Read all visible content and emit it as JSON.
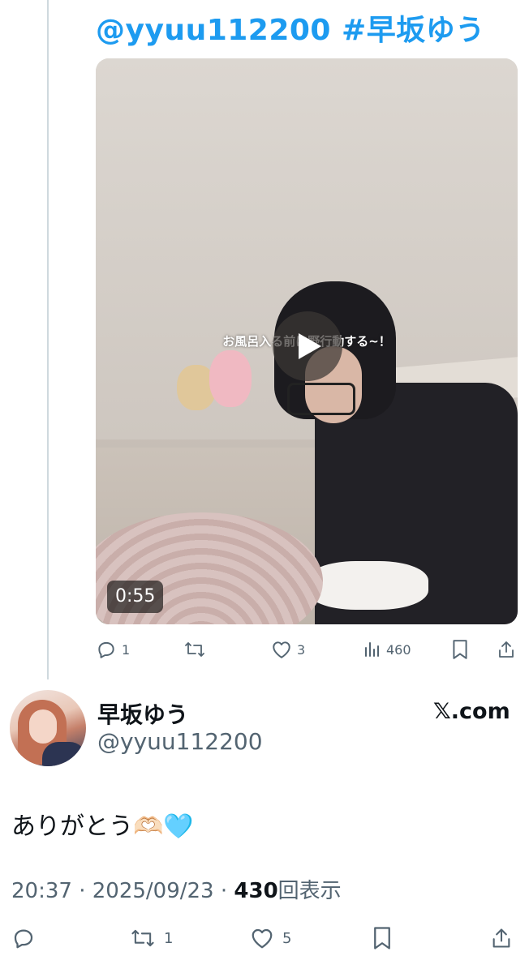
{
  "reply_context": {
    "mention": "@yyuu112200",
    "hashtag": "#早坂ゆう"
  },
  "video": {
    "overlay_caption": "お風呂入る前に野行動する~！",
    "duration": "0:55",
    "play_icon": "play-icon"
  },
  "quoted_actions": {
    "replies": "1",
    "reposts": "",
    "likes": "3",
    "views": "460"
  },
  "author": {
    "display_name": "早坂ゆう",
    "handle": "@yyuu112200",
    "source_label": "𝕏.com"
  },
  "tweet": {
    "text": "ありがとう🫶🏻🩵",
    "time": "20:37",
    "separator": "·",
    "date": "2025/09/23",
    "view_count": "430",
    "view_label": "回表示"
  },
  "main_actions": {
    "replies": "",
    "reposts": "1",
    "likes": "5"
  },
  "colors": {
    "link_blue": "#1d9bf0",
    "icon_gray": "#536471",
    "text_dark": "#0f1419"
  }
}
